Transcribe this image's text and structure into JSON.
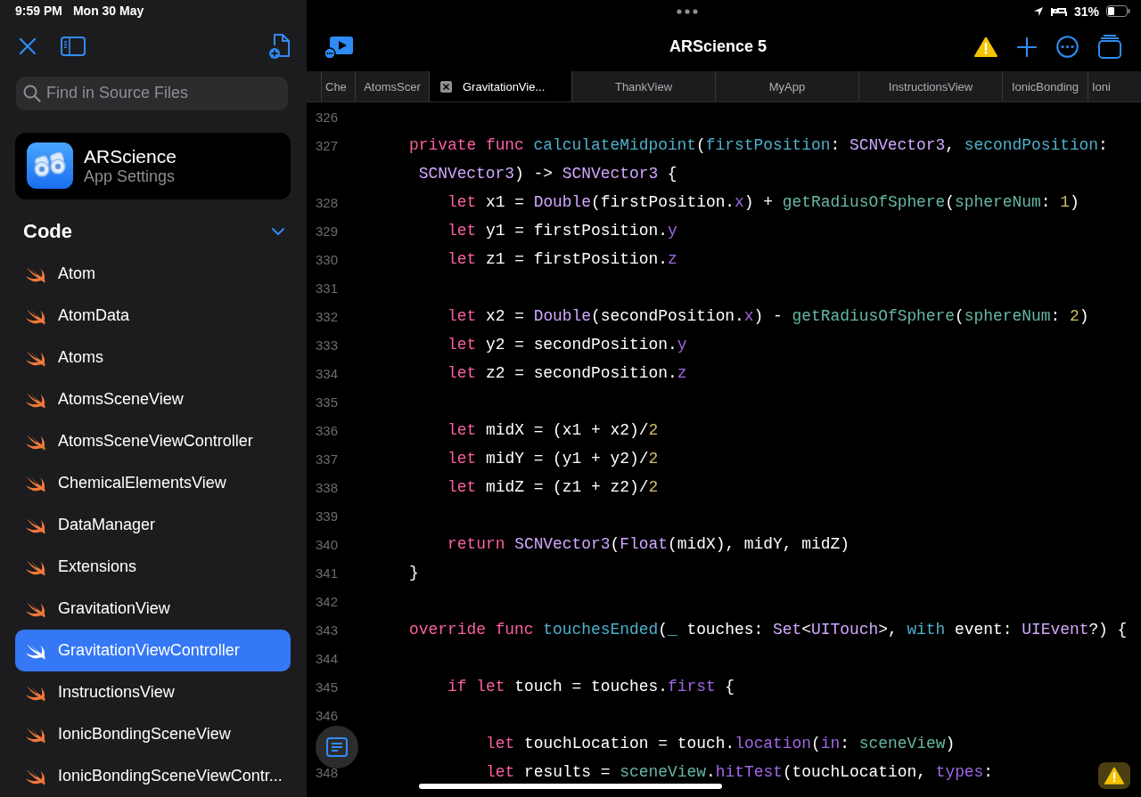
{
  "status_bar": {
    "time": "9:59 PM",
    "date": "Mon 30 May",
    "battery": "31%"
  },
  "sidebar": {
    "search": {
      "placeholder": "Find in Source Files"
    },
    "app_card": {
      "name": "ARScience",
      "subtitle": "App Settings"
    },
    "section": {
      "title": "Code",
      "expanded": true
    },
    "items": [
      {
        "label": "Atom",
        "selected": false
      },
      {
        "label": "AtomData",
        "selected": false
      },
      {
        "label": "Atoms",
        "selected": false
      },
      {
        "label": "AtomsSceneView",
        "selected": false
      },
      {
        "label": "AtomsSceneViewController",
        "selected": false
      },
      {
        "label": "ChemicalElementsView",
        "selected": false
      },
      {
        "label": "DataManager",
        "selected": false
      },
      {
        "label": "Extensions",
        "selected": false
      },
      {
        "label": "GravitationView",
        "selected": false
      },
      {
        "label": "GravitationViewController",
        "selected": true
      },
      {
        "label": "InstructionsView",
        "selected": false
      },
      {
        "label": "IonicBondingSceneView",
        "selected": false
      },
      {
        "label": "IonicBondingSceneViewContr...",
        "selected": false
      }
    ]
  },
  "editor": {
    "title": "ARScience 5",
    "tabs": [
      {
        "label": "Che",
        "selected": false
      },
      {
        "label": "AtomsScer",
        "selected": false
      },
      {
        "label": "GravitationVie...",
        "selected": true
      },
      {
        "label": "ThankView",
        "selected": false
      },
      {
        "label": "MyApp",
        "selected": false
      },
      {
        "label": "InstructionsView",
        "selected": false
      },
      {
        "label": "IonicBonding",
        "selected": false
      },
      {
        "label": "Ioni",
        "selected": false
      }
    ],
    "lines": [
      {
        "number": "326"
      },
      {
        "number": "327",
        "kind": "member",
        "tokens": [
          {
            "kind": "kw",
            "text": "private func"
          },
          {
            "kind": "decl",
            "text": " calculateMidpoint"
          },
          {
            "kind": "plain",
            "text": "("
          },
          {
            "kind": "decl",
            "text": "firstPosition"
          },
          {
            "kind": "plain",
            "text": ": "
          },
          {
            "kind": "type",
            "text": "SCNVector3"
          },
          {
            "kind": "plain",
            "text": ", "
          },
          {
            "kind": "decl",
            "text": "secondPosition"
          },
          {
            "kind": "plain",
            "text": ":"
          }
        ]
      },
      {
        "kind": "wrap",
        "tokens": [
          {
            "kind": "type",
            "text": "SCNVector3"
          },
          {
            "kind": "plain",
            "text": ") -> "
          },
          {
            "kind": "type",
            "text": "SCNVector3"
          },
          {
            "kind": "plain",
            "text": " {"
          }
        ]
      },
      {
        "number": "328",
        "kind": "body",
        "tokens": [
          {
            "kind": "kw",
            "text": "let"
          },
          {
            "kind": "plain",
            "text": " x1 = "
          },
          {
            "kind": "type",
            "text": "Double"
          },
          {
            "kind": "plain",
            "text": "(firstPosition."
          },
          {
            "kind": "prop",
            "text": "x"
          },
          {
            "kind": "plain",
            "text": ") + "
          },
          {
            "kind": "call",
            "text": "getRadiusOfSphere"
          },
          {
            "kind": "plain",
            "text": "("
          },
          {
            "kind": "call",
            "text": "sphereNum"
          },
          {
            "kind": "plain",
            "text": ": "
          },
          {
            "kind": "num",
            "text": "1"
          },
          {
            "kind": "plain",
            "text": ")"
          }
        ]
      },
      {
        "number": "329",
        "kind": "body",
        "tokens": [
          {
            "kind": "kw",
            "text": "let"
          },
          {
            "kind": "plain",
            "text": " y1 = firstPosition."
          },
          {
            "kind": "prop",
            "text": "y"
          }
        ]
      },
      {
        "number": "330",
        "kind": "body",
        "tokens": [
          {
            "kind": "kw",
            "text": "let"
          },
          {
            "kind": "plain",
            "text": " z1 = firstPosition."
          },
          {
            "kind": "prop",
            "text": "z"
          }
        ]
      },
      {
        "number": "331"
      },
      {
        "number": "332",
        "kind": "body",
        "tokens": [
          {
            "kind": "kw",
            "text": "let"
          },
          {
            "kind": "plain",
            "text": " x2 = "
          },
          {
            "kind": "type",
            "text": "Double"
          },
          {
            "kind": "plain",
            "text": "(secondPosition."
          },
          {
            "kind": "prop",
            "text": "x"
          },
          {
            "kind": "plain",
            "text": ") - "
          },
          {
            "kind": "call",
            "text": "getRadiusOfSphere"
          },
          {
            "kind": "plain",
            "text": "("
          },
          {
            "kind": "call",
            "text": "sphereNum"
          },
          {
            "kind": "plain",
            "text": ": "
          },
          {
            "kind": "num",
            "text": "2"
          },
          {
            "kind": "plain",
            "text": ")"
          }
        ]
      },
      {
        "number": "333",
        "kind": "body",
        "tokens": [
          {
            "kind": "kw",
            "text": "let"
          },
          {
            "kind": "plain",
            "text": " y2 = secondPosition."
          },
          {
            "kind": "prop",
            "text": "y"
          }
        ]
      },
      {
        "number": "334",
        "kind": "body",
        "tokens": [
          {
            "kind": "kw",
            "text": "let"
          },
          {
            "kind": "plain",
            "text": " z2 = secondPosition."
          },
          {
            "kind": "prop",
            "text": "z"
          }
        ]
      },
      {
        "number": "335"
      },
      {
        "number": "336",
        "kind": "body",
        "tokens": [
          {
            "kind": "kw",
            "text": "let"
          },
          {
            "kind": "plain",
            "text": " midX = (x1 + x2)/"
          },
          {
            "kind": "num",
            "text": "2"
          }
        ]
      },
      {
        "number": "337",
        "kind": "body",
        "tokens": [
          {
            "kind": "kw",
            "text": "let"
          },
          {
            "kind": "plain",
            "text": " midY = (y1 + y2)/"
          },
          {
            "kind": "num",
            "text": "2"
          }
        ]
      },
      {
        "number": "338",
        "kind": "body",
        "tokens": [
          {
            "kind": "kw",
            "text": "let"
          },
          {
            "kind": "plain",
            "text": " midZ = (z1 + z2)/"
          },
          {
            "kind": "num",
            "text": "2"
          }
        ]
      },
      {
        "number": "339"
      },
      {
        "number": "340",
        "kind": "body",
        "tokens": [
          {
            "kind": "kw",
            "text": "return"
          },
          {
            "kind": "type",
            "text": " SCNVector3"
          },
          {
            "kind": "plain",
            "text": "("
          },
          {
            "kind": "type",
            "text": "Float"
          },
          {
            "kind": "plain",
            "text": "(midX), midY, midZ)"
          }
        ]
      },
      {
        "number": "341",
        "kind": "member",
        "tokens": [
          {
            "kind": "plain",
            "text": "}"
          }
        ]
      },
      {
        "number": "342"
      },
      {
        "number": "343",
        "kind": "member",
        "tokens": [
          {
            "kind": "kw",
            "text": "override func"
          },
          {
            "kind": "decl",
            "text": " touchesEnded"
          },
          {
            "kind": "plain",
            "text": "("
          },
          {
            "kind": "decl",
            "text": "_"
          },
          {
            "kind": "plain",
            "text": " touches: "
          },
          {
            "kind": "type",
            "text": "Set"
          },
          {
            "kind": "plain",
            "text": "<"
          },
          {
            "kind": "type",
            "text": "UITouch"
          },
          {
            "kind": "plain",
            "text": ">, "
          },
          {
            "kind": "decl",
            "text": "with"
          },
          {
            "kind": "plain",
            "text": " event: "
          },
          {
            "kind": "type",
            "text": "UIEvent"
          },
          {
            "kind": "plain",
            "text": "?) {"
          }
        ]
      },
      {
        "number": "344"
      },
      {
        "number": "345",
        "kind": "body",
        "tokens": [
          {
            "kind": "kw",
            "text": "if let"
          },
          {
            "kind": "plain",
            "text": " touch = touches."
          },
          {
            "kind": "prop",
            "text": "first"
          },
          {
            "kind": "plain",
            "text": " {"
          }
        ]
      },
      {
        "number": "346"
      },
      {
        "kind": "inner",
        "tokens": [
          {
            "kind": "kw",
            "text": "let"
          },
          {
            "kind": "plain",
            "text": " touchLocation = touch."
          },
          {
            "kind": "prop",
            "text": "location"
          },
          {
            "kind": "plain",
            "text": "("
          },
          {
            "kind": "prop",
            "text": "in"
          },
          {
            "kind": "plain",
            "text": ": "
          },
          {
            "kind": "call",
            "text": "sceneView"
          },
          {
            "kind": "plain",
            "text": ")"
          }
        ]
      },
      {
        "number": "348",
        "kind": "inner",
        "tokens": [
          {
            "kind": "kw",
            "text": "let"
          },
          {
            "kind": "plain",
            "text": " results = "
          },
          {
            "kind": "call",
            "text": "sceneView"
          },
          {
            "kind": "plain",
            "text": "."
          },
          {
            "kind": "prop",
            "text": "hitTest"
          },
          {
            "kind": "plain",
            "text": "(touchLocation, "
          },
          {
            "kind": "prop",
            "text": "types"
          },
          {
            "kind": "plain",
            "text": ":"
          }
        ]
      }
    ]
  }
}
